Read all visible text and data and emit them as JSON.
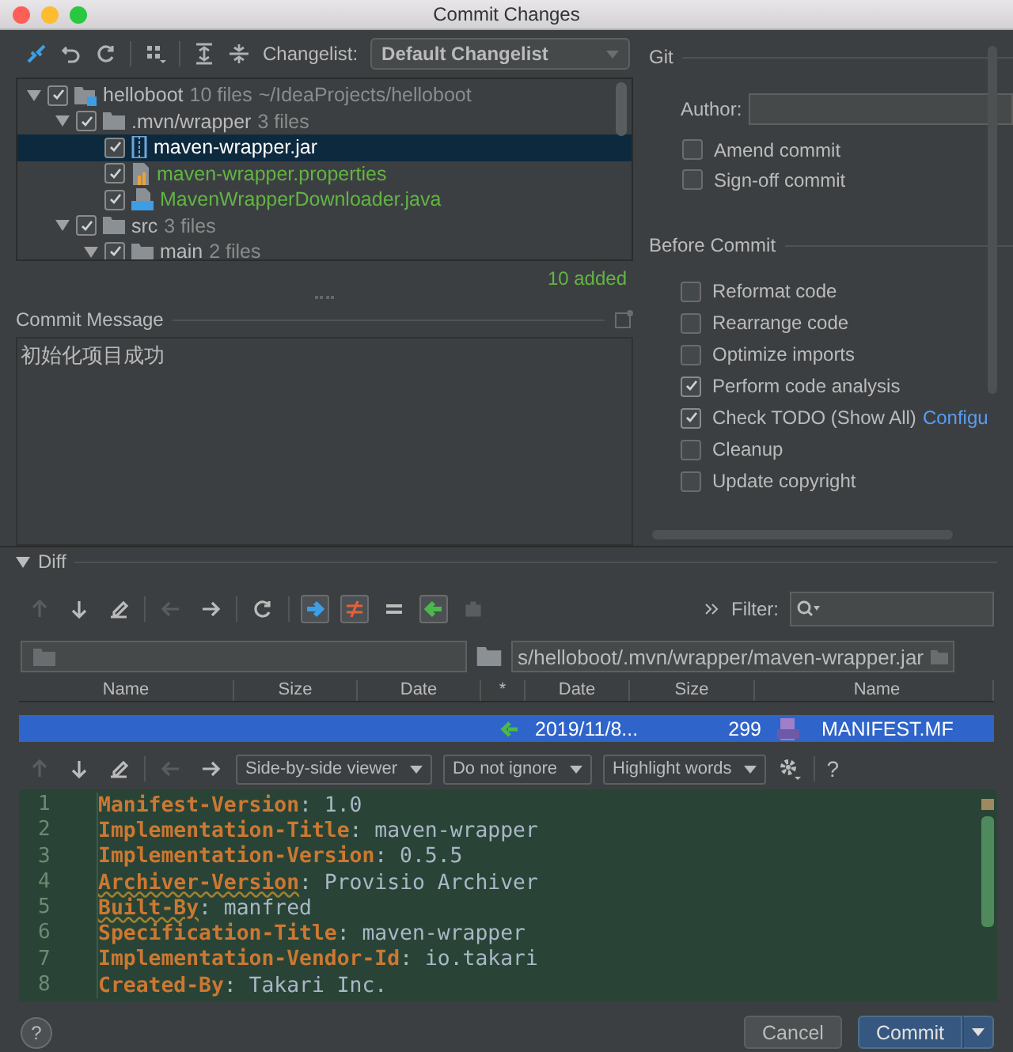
{
  "window": {
    "title": "Commit Changes"
  },
  "changes_toolbar": {
    "changelist_label": "Changelist:",
    "changelist": "Default Changelist"
  },
  "tree": [
    {
      "kind": "module",
      "name": "helloboot",
      "count": "10 files",
      "path": "~/IdeaProjects/helloboot",
      "checked": true,
      "expanded": true,
      "selected": false,
      "color": "#bbbbbb",
      "children": [
        {
          "kind": "folder",
          "name": ".mvn/wrapper",
          "count": "3 files",
          "checked": true,
          "expanded": true,
          "selected": false,
          "color": "#bbbbbb",
          "children": [
            {
              "kind": "jar",
              "name": "maven-wrapper.jar",
              "checked": true,
              "selected": true,
              "color": "#ffffff"
            },
            {
              "kind": "properties",
              "name": "maven-wrapper.properties",
              "checked": true,
              "selected": false,
              "color": "#62b543"
            },
            {
              "kind": "java",
              "name": "MavenWrapperDownloader.java",
              "checked": true,
              "selected": false,
              "color": "#62b543"
            }
          ]
        },
        {
          "kind": "folder",
          "name": "src",
          "count": "3 files",
          "checked": true,
          "expanded": true,
          "selected": false,
          "color": "#bbbbbb",
          "children": [
            {
              "kind": "folder",
              "name": "main",
              "count": "2 files",
              "checked": true,
              "expanded": true,
              "selected": false,
              "color": "#bbbbbb"
            }
          ]
        }
      ]
    }
  ],
  "added_summary": "10 added",
  "commit_message": {
    "label": "Commit Message",
    "value": "初始化项目成功"
  },
  "git": {
    "title": "Git",
    "author_label": "Author:",
    "options": [
      {
        "label": "Amend commit",
        "checked": false
      },
      {
        "label": "Sign-off commit",
        "checked": false
      }
    ]
  },
  "before_commit": {
    "title": "Before Commit",
    "options": [
      {
        "label": "Reformat code",
        "checked": false
      },
      {
        "label": "Rearrange code",
        "checked": false
      },
      {
        "label": "Optimize imports",
        "checked": false
      },
      {
        "label": "Perform code analysis",
        "checked": true
      },
      {
        "label": "Check TODO (Show All)",
        "checked": true,
        "link": "Configu"
      },
      {
        "label": "Cleanup",
        "checked": false
      },
      {
        "label": "Update copyright",
        "checked": false
      }
    ]
  },
  "diff": {
    "title": "Diff",
    "expanded": true,
    "toolbar": [
      {
        "kind": "up",
        "disabled": true
      },
      {
        "kind": "down",
        "disabled": false
      },
      {
        "kind": "edit",
        "disabled": false
      },
      {
        "kind": "sep"
      },
      {
        "kind": "back",
        "disabled": true
      },
      {
        "kind": "forward",
        "disabled": false
      },
      {
        "kind": "sep"
      },
      {
        "kind": "refresh",
        "disabled": false
      },
      {
        "kind": "sep"
      },
      {
        "kind": "right-arrow",
        "disabled": false,
        "selected": true
      },
      {
        "kind": "not-equal",
        "disabled": false,
        "selected": true
      },
      {
        "kind": "equal",
        "disabled": false,
        "selected": false
      },
      {
        "kind": "left-arrow",
        "disabled": false,
        "selected": true
      },
      {
        "kind": "plugin",
        "disabled": true
      }
    ],
    "filter_label": "Filter:",
    "right_path": "s/helloboot/.mvn/wrapper/maven-wrapper.jar",
    "columns": [
      "Name",
      "Size",
      "Date",
      "*",
      "Date",
      "Size",
      "Name"
    ],
    "rows": [
      {
        "selected": true,
        "right_date": "2019/11/8...",
        "right_size": "299",
        "right_name": "MANIFEST.MF"
      }
    ],
    "viewer_toolbar": [
      {
        "kind": "up",
        "disabled": true
      },
      {
        "kind": "down",
        "disabled": false
      },
      {
        "kind": "edit",
        "disabled": false
      },
      {
        "kind": "sep"
      },
      {
        "kind": "back",
        "disabled": true
      },
      {
        "kind": "forward",
        "disabled": false
      }
    ],
    "dropdowns": [
      "Side-by-side viewer",
      "Do not ignore",
      "Highlight words"
    ],
    "help": "?",
    "lines": [
      {
        "number": "1",
        "key": "Manifest-Version",
        "value": ": 1.0",
        "warning": false
      },
      {
        "number": "2",
        "key": "Implementation-Title",
        "value": ": maven-wrapper",
        "warning": false
      },
      {
        "number": "3",
        "key": "Implementation-Version",
        "value": ": 0.5.5",
        "warning": false
      },
      {
        "number": "4",
        "key": "Archiver-Version",
        "value": ": Provisio Archiver",
        "warning": true
      },
      {
        "number": "5",
        "key": "Built-By",
        "value": ": manfred",
        "warning": true
      },
      {
        "number": "6",
        "key": "Specification-Title",
        "value": ": maven-wrapper",
        "warning": false
      },
      {
        "number": "7",
        "key": "Implementation-Vendor-Id",
        "value": ": io.takari",
        "warning": false
      },
      {
        "number": "8",
        "key": "Created-By",
        "value": ": Takari Inc.",
        "warning": false
      }
    ]
  },
  "footer": {
    "help": "?",
    "cancel": "Cancel",
    "commit": "Commit"
  }
}
